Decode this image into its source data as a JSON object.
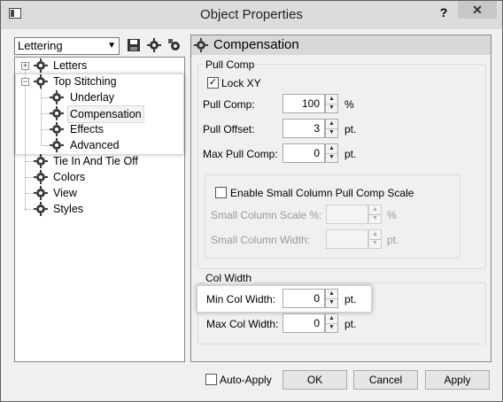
{
  "window": {
    "title": "Object Properties",
    "help": "?",
    "close": "✕"
  },
  "combo": {
    "value": "Lettering"
  },
  "tree": {
    "items": [
      {
        "label": "Letters"
      },
      {
        "label": "Top Stitching"
      },
      {
        "label": "Underlay"
      },
      {
        "label": "Compensation"
      },
      {
        "label": "Effects"
      },
      {
        "label": "Advanced"
      },
      {
        "label": "Tie In And Tie Off"
      },
      {
        "label": "Colors"
      },
      {
        "label": "View"
      },
      {
        "label": "Styles"
      }
    ],
    "expand_plus": "+",
    "expand_minus": "−",
    "selected": "Compensation"
  },
  "panel": {
    "title": "Compensation",
    "pull_comp_group": "Pull Comp",
    "lock_xy": {
      "label": "Lock XY",
      "checked": true,
      "mark": "✓"
    },
    "pull_comp": {
      "label": "Pull Comp:",
      "value": "100",
      "unit": "%"
    },
    "pull_offset": {
      "label": "Pull Offset:",
      "value": "3",
      "unit": "pt."
    },
    "max_pull_comp": {
      "label": "Max Pull Comp:",
      "value": "0",
      "unit": "pt."
    },
    "small_col": {
      "enable_label": "Enable Small Column Pull Comp Scale",
      "scale_label": "Small Column Scale %:",
      "scale_value": "",
      "scale_unit": "%",
      "width_label": "Small Column Width:",
      "width_value": "",
      "width_unit": "pt."
    },
    "col_width_group": "Col Width",
    "min_col_width": {
      "label": "Min Col Width:",
      "value": "0",
      "unit": "pt."
    },
    "max_col_width": {
      "label": "Max Col Width:",
      "value": "0",
      "unit": "pt."
    }
  },
  "footer": {
    "auto_apply": "Auto-Apply",
    "ok": "OK",
    "cancel": "Cancel",
    "apply": "Apply"
  },
  "spin_up": "▲",
  "spin_down": "▼",
  "combo_arrow": "⌄"
}
